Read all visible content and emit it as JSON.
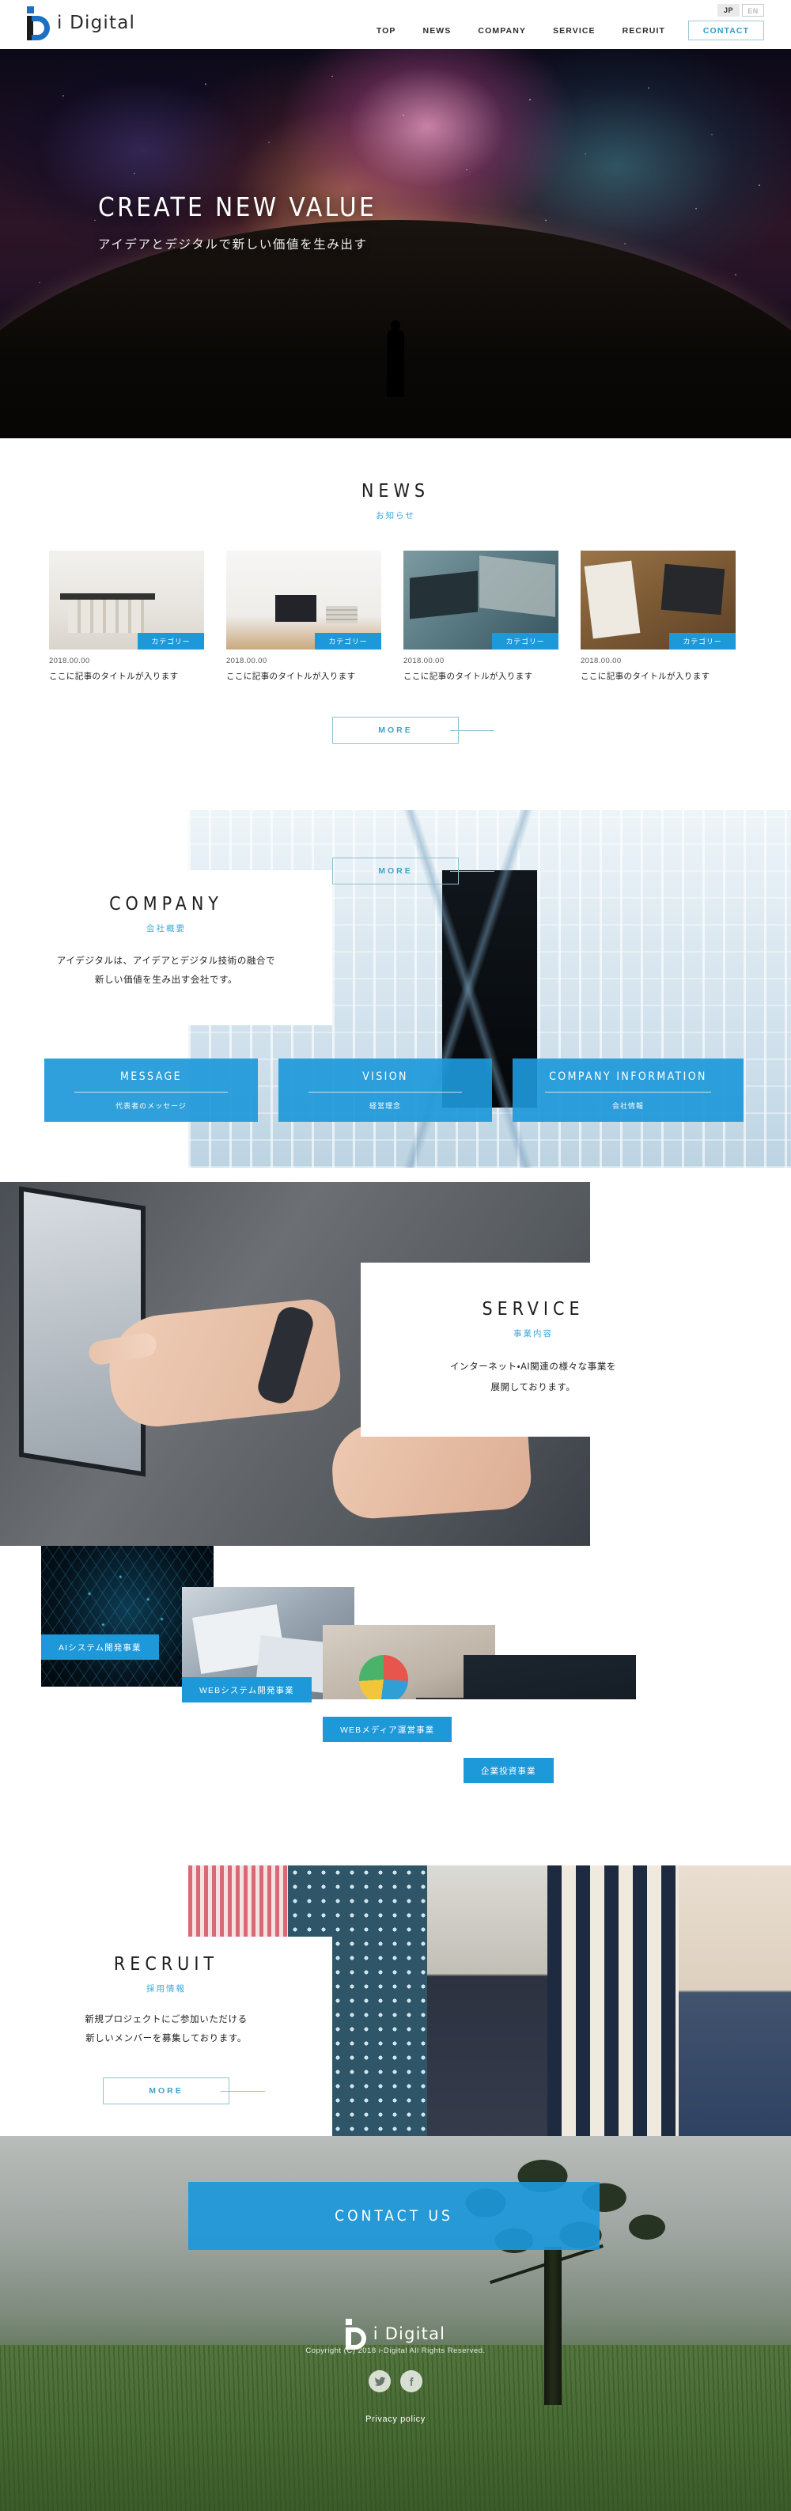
{
  "brand": {
    "name": "i Digital"
  },
  "header": {
    "lang": {
      "active": "JP",
      "inactive": "EN"
    },
    "nav": [
      {
        "label": "TOP"
      },
      {
        "label": "NEWS"
      },
      {
        "label": "COMPANY"
      },
      {
        "label": "SERVICE"
      },
      {
        "label": "RECRUIT"
      }
    ],
    "contact_label": "CONTACT"
  },
  "hero": {
    "title": "CREATE NEW VALUE",
    "subtitle": "アイデアとデジタルで新しい価値を生み出す"
  },
  "news": {
    "heading_en": "NEWS",
    "heading_ja": "お知らせ",
    "more_label": "MORE",
    "items": [
      {
        "badge": "カテゴリー",
        "date": "2018.00.00",
        "title": "ここに記事のタイトルが入ります"
      },
      {
        "badge": "カテゴリー",
        "date": "2018.00.00",
        "title": "ここに記事のタイトルが入ります"
      },
      {
        "badge": "カテゴリー",
        "date": "2018.00.00",
        "title": "ここに記事のタイトルが入ります"
      },
      {
        "badge": "カテゴリー",
        "date": "2018.00.00",
        "title": "ここに記事のタイトルが入ります"
      }
    ]
  },
  "company": {
    "heading_en": "COMPANY",
    "heading_ja": "会社概要",
    "body_line1": "アイデジタルは、アイデアとデジタル技術の融合で",
    "body_line2": "新しい価値を生み出す会社です。",
    "buttons": [
      {
        "en": "MESSAGE",
        "ja": "代表者のメッセージ"
      },
      {
        "en": "VISION",
        "ja": "経営理念"
      },
      {
        "en": "COMPANY INFORMATION",
        "ja": "会社情報"
      }
    ]
  },
  "service": {
    "heading_en": "SERVICE",
    "heading_ja": "事業内容",
    "body_line1": "インターネット・AI関連の様々な事業を",
    "body_line2": "展開しております。",
    "more_label": "MORE",
    "tiles": [
      {
        "label": "AIシステム開発事業"
      },
      {
        "label": "WEBシステム開発事業"
      },
      {
        "label": "WEBメディア運営事業"
      },
      {
        "label": "企業投資事業"
      }
    ]
  },
  "recruit": {
    "heading_en": "RECRUIT",
    "heading_ja": "採用情報",
    "body_line1": "新規プロジェクトにご参加いただける",
    "body_line2": "新しいメンバーを募集しております。",
    "more_label": "MORE"
  },
  "contact": {
    "banner_label": "CONTACT US"
  },
  "footer": {
    "logo_text": "i Digital",
    "privacy_label": "Privacy policy",
    "copyright": "Copyright (C) 2018 i-Digital All Rights Reserved.",
    "social": [
      {
        "name": "twitter"
      },
      {
        "name": "facebook"
      }
    ]
  },
  "colors": {
    "accent": "#1d98d9",
    "link": "#38a8dd",
    "more": "#3fa3c4"
  }
}
